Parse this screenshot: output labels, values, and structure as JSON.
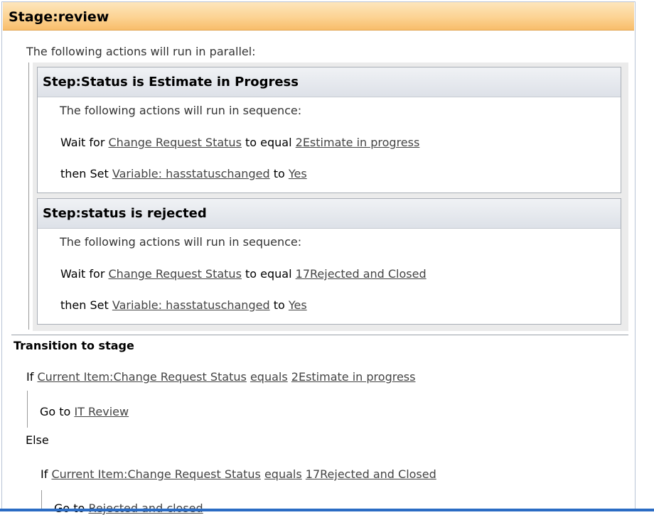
{
  "stage": {
    "prefix": "Stage:",
    "name": "review"
  },
  "parallel_text": "The following actions will run in parallel:",
  "steps": [
    {
      "prefix": "Step:",
      "name": "Status is Estimate in Progress",
      "sequence_text": "The following actions will run in sequence:",
      "wait": {
        "label": "Wait for",
        "field": "Change Request Status",
        "op": "to equal",
        "value": "2Estimate in progress"
      },
      "set": {
        "label": "then Set",
        "variable": "Variable: hasstatuschanged",
        "to": "to",
        "value": "Yes"
      }
    },
    {
      "prefix": "Step:",
      "name": "status is rejected",
      "sequence_text": "The following actions will run in sequence:",
      "wait": {
        "label": "Wait for",
        "field": "Change Request Status",
        "op": "to equal",
        "value": "17Rejected and Closed"
      },
      "set": {
        "label": "then Set",
        "variable": "Variable: hasstatuschanged",
        "to": "to",
        "value": "Yes"
      }
    }
  ],
  "transition": {
    "title": "Transition to stage",
    "if1": {
      "kw": "If",
      "field": "Current Item:Change Request Status",
      "op": "equals",
      "value": "2Estimate in progress"
    },
    "goto1": {
      "kw": "Go to",
      "target": "IT Review"
    },
    "else": "Else",
    "if2": {
      "kw": "If",
      "field": "Current Item:Change Request Status",
      "op": "equals",
      "value": "17Rejected and Closed"
    },
    "goto2": {
      "kw": "Go to",
      "target": "Rejected and closed"
    }
  }
}
